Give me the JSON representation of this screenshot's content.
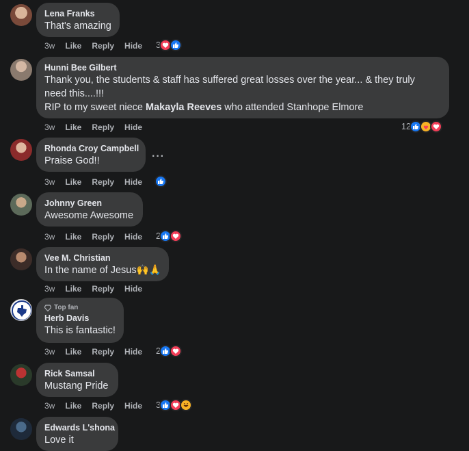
{
  "comments": [
    {
      "author": "Lena Franks",
      "badge": "",
      "lines": [
        "That's amazing"
      ],
      "time": "3w",
      "like_label": "Like",
      "reply_label": "Reply",
      "hide_label": "Hide",
      "reaction_count": "3",
      "reactions": [
        "love-icon",
        "like-icon"
      ]
    },
    {
      "author": "Hunni Bee Gilbert",
      "badge": "",
      "lines": [
        "Thank you, the students & staff has suffered great losses over the year... & they truly",
        "need this....!!!",
        "RIP to my sweet niece Makayla Reeves who attended Stanhope Elmore"
      ],
      "bold_name": "Makayla Reeves",
      "time": "3w",
      "like_label": "Like",
      "reply_label": "Reply",
      "hide_label": "Hide",
      "reaction_count": "12",
      "reactions": [
        "like-icon",
        "care-icon",
        "love-icon"
      ]
    },
    {
      "author": "Rhonda Croy Campbell",
      "badge": "",
      "lines": [
        "Praise God!!"
      ],
      "time": "3w",
      "like_label": "Like",
      "reply_label": "Reply",
      "hide_label": "Hide",
      "reaction_count": "",
      "reactions": [
        "like-icon"
      ],
      "more_label": "···"
    },
    {
      "author": "Johnny Green",
      "badge": "",
      "lines": [
        "Awesome Awesome"
      ],
      "time": "3w",
      "like_label": "Like",
      "reply_label": "Reply",
      "hide_label": "Hide",
      "reaction_count": "2",
      "reactions": [
        "like-icon",
        "love-icon"
      ]
    },
    {
      "author": "Vee M. Christian",
      "badge": "",
      "lines": [
        "In the name of Jesus🙌🙏"
      ],
      "time": "3w",
      "like_label": "Like",
      "reply_label": "Reply",
      "hide_label": "Hide",
      "reaction_count": "",
      "reactions": []
    },
    {
      "author": "Herb Davis",
      "badge": "Top fan",
      "lines": [
        "This is fantastic!"
      ],
      "time": "3w",
      "like_label": "Like",
      "reply_label": "Reply",
      "hide_label": "Hide",
      "reaction_count": "2",
      "reactions": [
        "like-icon",
        "love-icon"
      ]
    },
    {
      "author": "Rick Samsal",
      "badge": "",
      "lines": [
        "Mustang Pride"
      ],
      "time": "3w",
      "like_label": "Like",
      "reply_label": "Reply",
      "hide_label": "Hide",
      "reaction_count": "3",
      "reactions": [
        "like-icon",
        "love-icon",
        "haha-icon"
      ]
    },
    {
      "author": "Edwards L'shona",
      "badge": "",
      "lines": [
        "Love it"
      ],
      "time": "",
      "like_label": "",
      "reply_label": "",
      "hide_label": "",
      "reaction_count": "",
      "reactions": []
    }
  ],
  "colors": {
    "background": "#18191a",
    "bubble": "#3a3b3c",
    "text": "#e4e6eb",
    "secondary": "#b0b3b8",
    "like": "#1877f2",
    "love": "#f33e58",
    "care": "#f7b125"
  }
}
